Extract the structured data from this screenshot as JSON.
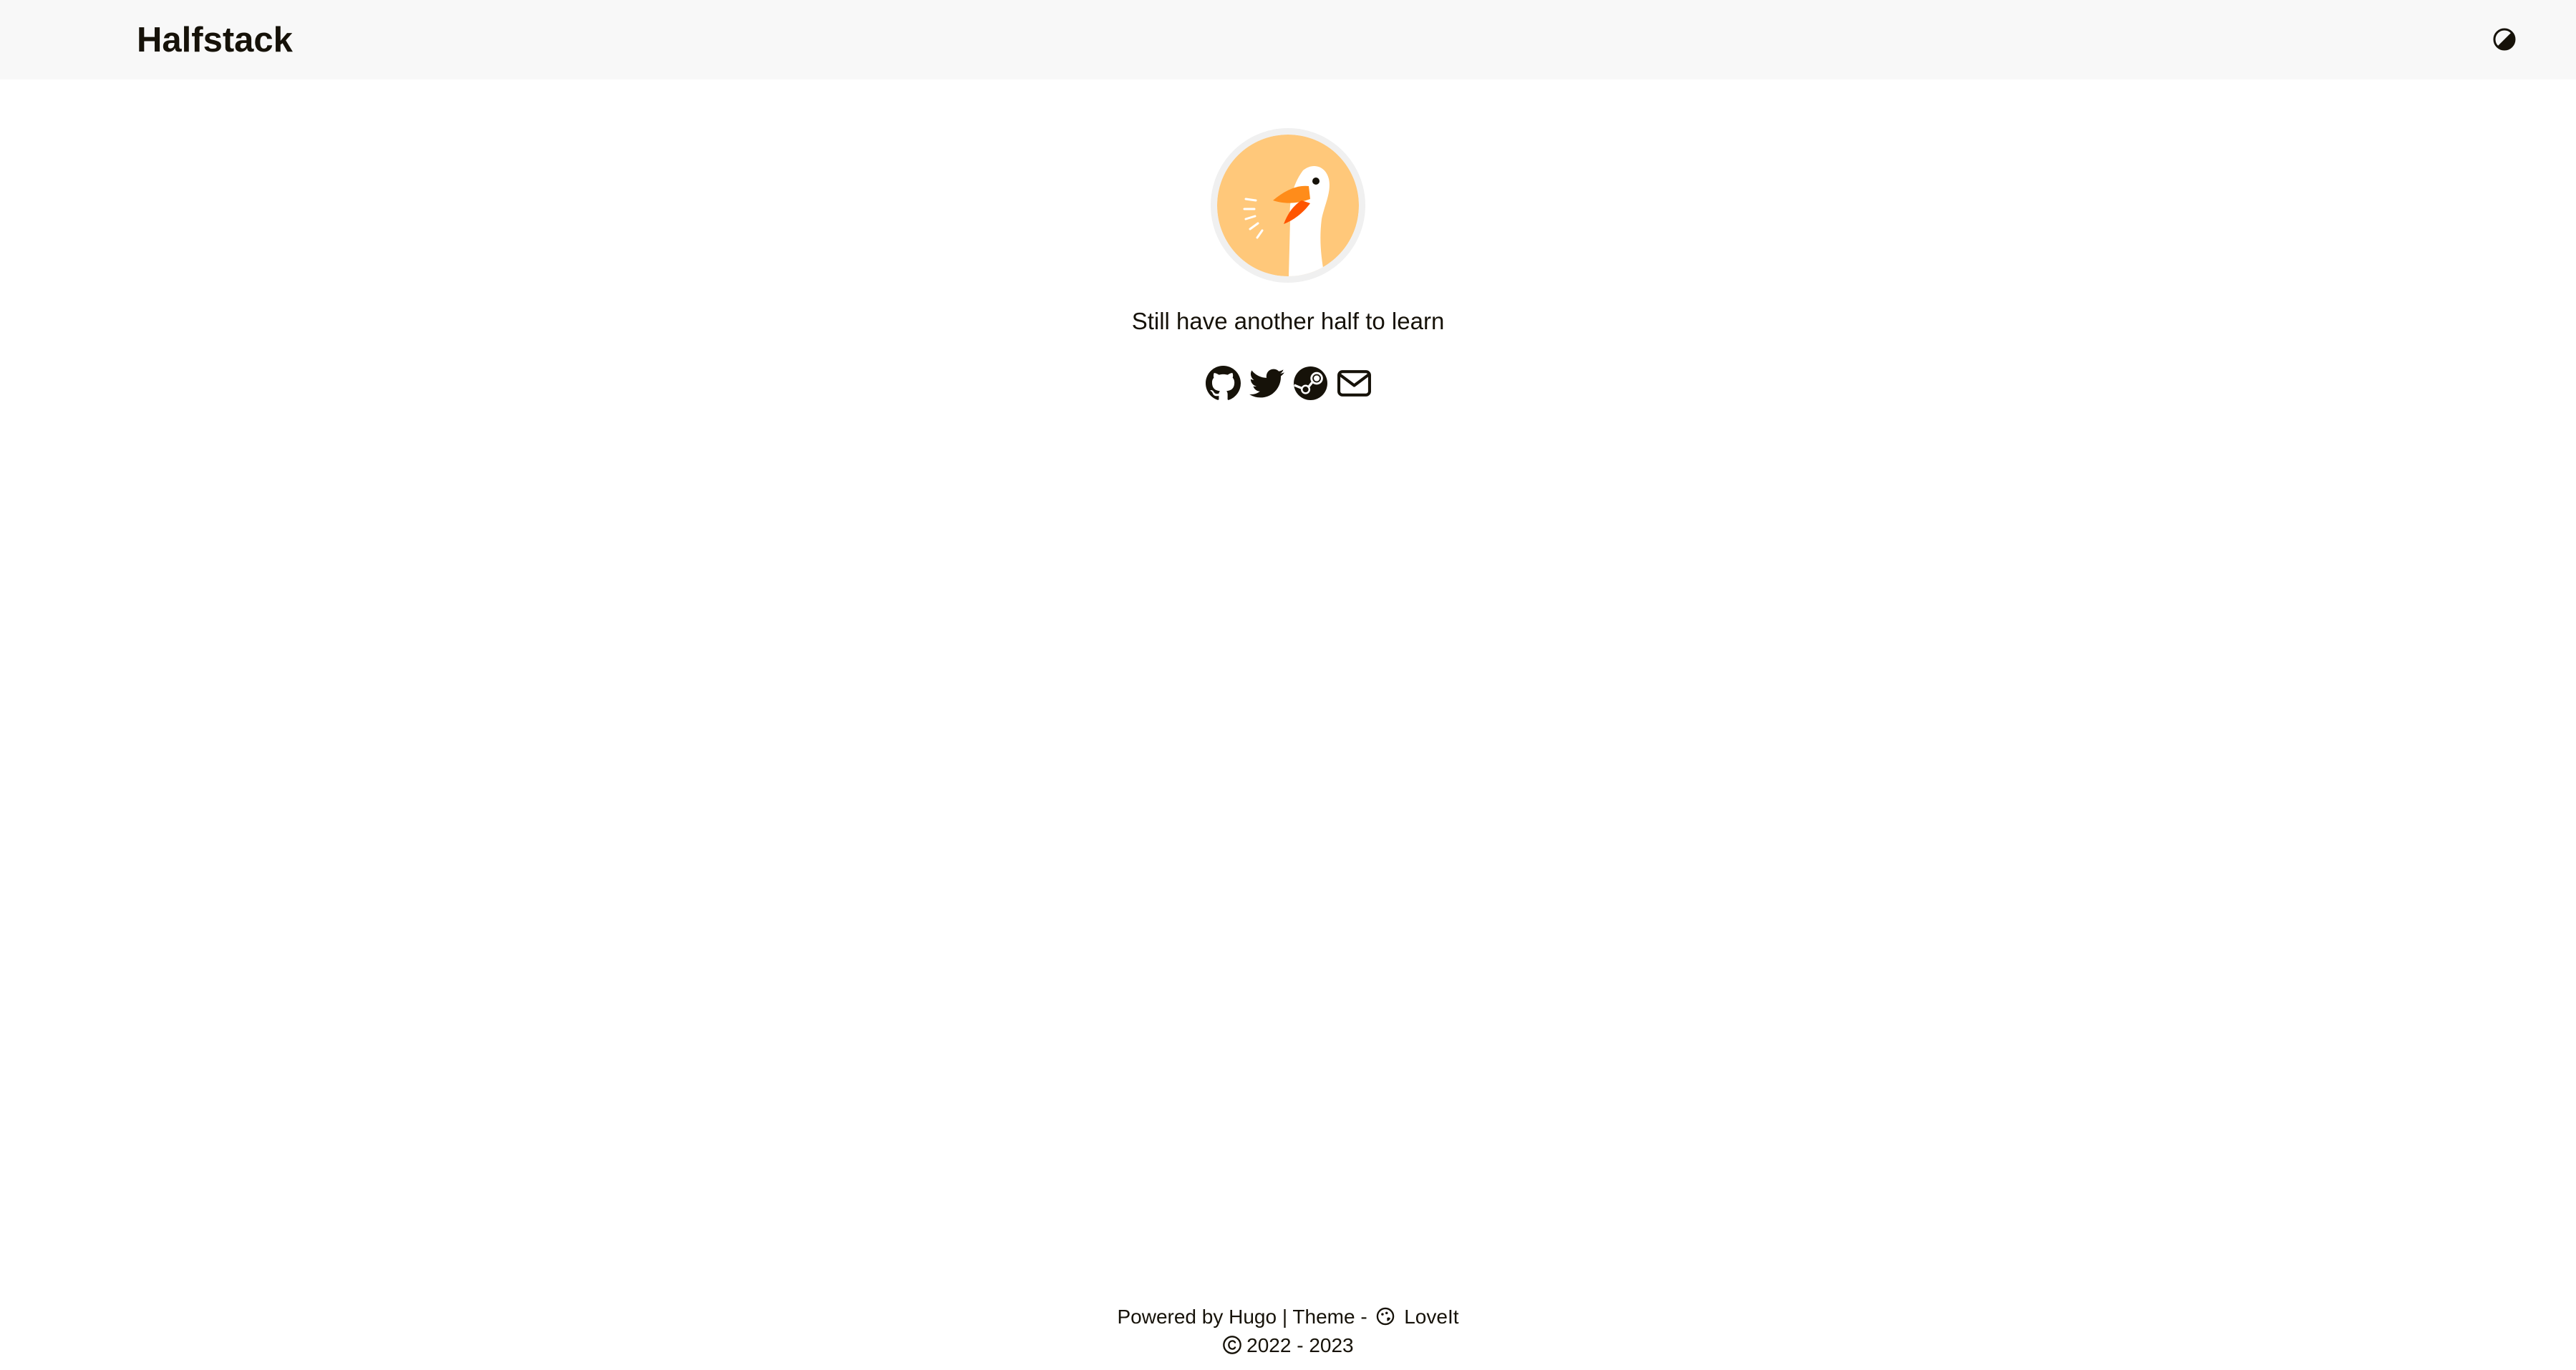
{
  "header": {
    "site_title": "Halfstack",
    "theme_switch_icon": "half-circle-contrast-icon"
  },
  "profile": {
    "avatar_icon": "goose-avatar",
    "subtitle": "Still have another half to learn",
    "social": [
      {
        "name": "github",
        "icon": "github-icon"
      },
      {
        "name": "twitter",
        "icon": "twitter-icon"
      },
      {
        "name": "steam",
        "icon": "steam-icon"
      },
      {
        "name": "email",
        "icon": "envelope-icon"
      }
    ]
  },
  "footer": {
    "powered_prefix": "Powered by",
    "powered_link": "Hugo",
    "separator": "|",
    "theme_prefix": "Theme -",
    "theme_link": "LoveIt",
    "copyright_years": "2022 - 2023"
  },
  "colors": {
    "header_bg": "#f8f8f8",
    "text": "#161209",
    "avatar_bg": "#ffc87a",
    "beak": "#ff7a00"
  }
}
